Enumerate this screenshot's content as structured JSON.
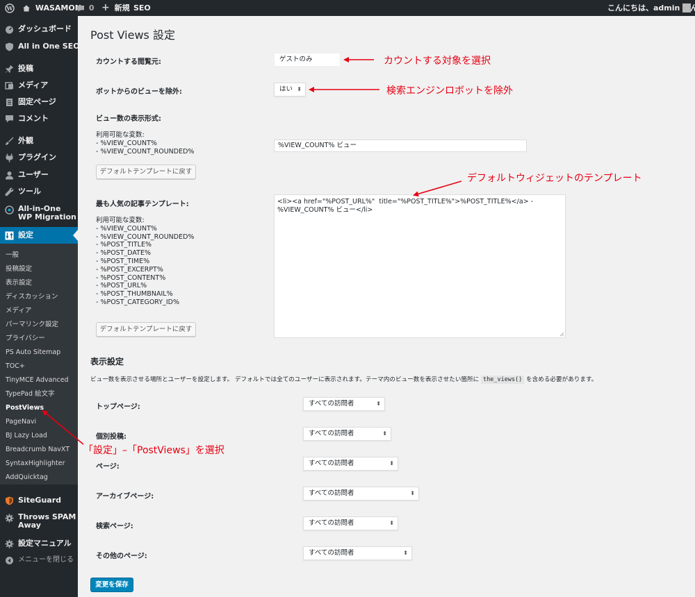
{
  "adminbar": {
    "site_name": "WASAMON",
    "comments_count": "0",
    "new_label": "新規",
    "seo_label": "SEO",
    "greeting": "こんにちは、admin さん"
  },
  "sidebar": {
    "items": [
      {
        "label": "ダッシュボード",
        "icon": "dashboard-icon"
      },
      {
        "label": "All in One SEO",
        "icon": "shield-icon"
      },
      {
        "label": "投稿",
        "icon": "pin-icon"
      },
      {
        "label": "メディア",
        "icon": "media-icon"
      },
      {
        "label": "固定ページ",
        "icon": "page-icon"
      },
      {
        "label": "コメント",
        "icon": "comment-icon"
      },
      {
        "label": "外観",
        "icon": "brush-icon"
      },
      {
        "label": "プラグイン",
        "icon": "plugin-icon"
      },
      {
        "label": "ユーザー",
        "icon": "user-icon"
      },
      {
        "label": "ツール",
        "icon": "wrench-icon"
      },
      {
        "label": "All-in-One WP Migration",
        "icon": "migration-icon"
      },
      {
        "label": "設定",
        "icon": "settings-icon"
      },
      {
        "label": "SiteGuard",
        "icon": "siteguard-icon"
      },
      {
        "label": "Throws SPAM Away",
        "icon": "gear-icon"
      },
      {
        "label": "設定マニュアル",
        "icon": "gear-icon"
      },
      {
        "label": "メニューを閉じる",
        "icon": "collapse-icon"
      }
    ],
    "submenu": [
      "一般",
      "投稿設定",
      "表示設定",
      "ディスカッション",
      "メディア",
      "パーマリンク設定",
      "プライバシー",
      "PS Auto Sitemap",
      "TOC+",
      "TinyMCE Advanced",
      "TypePad 絵文字",
      "PostViews",
      "PageNavi",
      "BJ Lazy Load",
      "Breadcrumb NavXT",
      "SyntaxHighlighter",
      "AddQuicktag"
    ]
  },
  "main": {
    "title": "Post Views 設定",
    "count_label": "カウントする閲覧元:",
    "count_value": "ゲストのみ",
    "bot_label": "ボットからのビューを除外:",
    "bot_value": "はい",
    "format_label": "ビュー数の表示形式:",
    "format_help": "利用可能な変数:\n- %VIEW_COUNT%\n- %VIEW_COUNT_ROUNDED%",
    "format_value": "%VIEW_COUNT% ビュー",
    "reset_button": "デフォルトテンプレートに戻す",
    "popular_label": "最も人気の記事テンプレート:",
    "popular_help": "利用可能な変数:\n- %VIEW_COUNT%\n- %VIEW_COUNT_ROUNDED%\n- %POST_TITLE%\n- %POST_DATE%\n- %POST_TIME%\n- %POST_EXCERPT%\n- %POST_CONTENT%\n- %POST_URL%\n- %POST_THUMBNAIL%\n- %POST_CATEGORY_ID%",
    "popular_template_line1": "<li><a href=\"%POST_URL%\"  title=\"%POST_TITLE%\">%POST_TITLE%</a> -",
    "popular_template_line2": "%VIEW_COUNT% ビュー</li>",
    "display_heading": "表示設定",
    "display_desc_before": "ビュー数を表示させる場所とユーザーを設定します。 デフォルトでは全てのユーザーに表示されます。テーマ内のビュー数を表示させたい箇所に",
    "display_code": "the_views()",
    "display_desc_after": "を含める必要があります。",
    "display_rows": [
      {
        "label": "トップページ:",
        "value": "すべての訪問者"
      },
      {
        "label": "個別投稿:",
        "value": "すべての訪問者"
      },
      {
        "label": "ページ:",
        "value": "すべての訪問者"
      },
      {
        "label": "アーカイブページ:",
        "value": "すべての訪問者"
      },
      {
        "label": "検索ページ:",
        "value": "すべての訪問者"
      },
      {
        "label": "その他のページ:",
        "value": "すべての訪問者"
      }
    ],
    "save_button": "変更を保存"
  },
  "annotations": {
    "count": "カウントする対象を選択",
    "bot": "検索エンジンロボットを除外",
    "widget": "デフォルトウィジェットのテンプレート",
    "menu": "「設定」–「PostViews」を選択"
  },
  "colors": {
    "adminbar": "#23282d",
    "active": "#0073aa",
    "annotation": "#e60012",
    "primary": "#0085ba"
  }
}
